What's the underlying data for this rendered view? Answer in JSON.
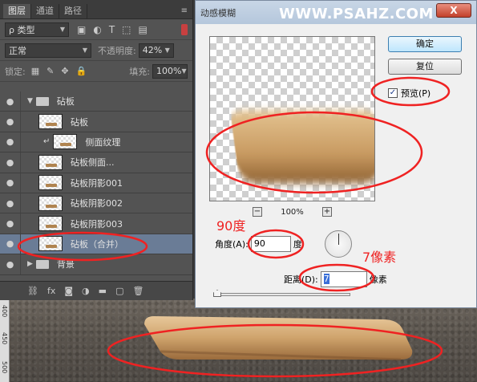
{
  "layers_panel": {
    "tabs": [
      "图层",
      "通道",
      "路径"
    ],
    "filter_kind": "ρ 类型",
    "blend_mode": "正常",
    "opacity_label": "不透明度:",
    "opacity_value": "42%",
    "lock_label": "锁定:",
    "fill_label": "填充:",
    "fill_value": "100%",
    "layers": [
      {
        "name": "砧板",
        "type": "group"
      },
      {
        "name": "砧板",
        "type": "layer"
      },
      {
        "name": "侧面纹理",
        "type": "clipped"
      },
      {
        "name": "砧板侧面...",
        "type": "layer"
      },
      {
        "name": "砧板阴影001",
        "type": "layer"
      },
      {
        "name": "砧板阴影002",
        "type": "layer"
      },
      {
        "name": "砧板阴影003",
        "type": "layer"
      },
      {
        "name": "砧板（合并）",
        "type": "layer",
        "selected": true
      },
      {
        "name": "背景",
        "type": "group"
      }
    ],
    "bottom_icons": [
      "link-icon",
      "fx-icon",
      "mask-icon",
      "adjustment-icon",
      "folder-icon",
      "new-layer-icon",
      "trash-icon"
    ],
    "fx_label": "fx"
  },
  "dialog": {
    "title": "动感模糊",
    "watermark": "WWW.PSAHZ.COM",
    "close_label": "X",
    "ok_label": "确定",
    "reset_label": "复位",
    "preview_label": "预览(P)",
    "preview_checked": true,
    "zoom_out": "−",
    "zoom_value": "100%",
    "zoom_in": "+",
    "angle_label": "角度(A):",
    "angle_value": "90",
    "angle_unit": "度",
    "distance_label": "距离(D):",
    "distance_value": "7",
    "distance_unit": "像素"
  },
  "annotations": {
    "angle_note": "90度",
    "distance_note": "7像素"
  },
  "ruler": {
    "marks": [
      "400",
      "450",
      "500"
    ]
  },
  "colors": {
    "annotation_red": "#ef2222",
    "selection_blue": "#6a7c96",
    "panel_bg": "#535353"
  }
}
